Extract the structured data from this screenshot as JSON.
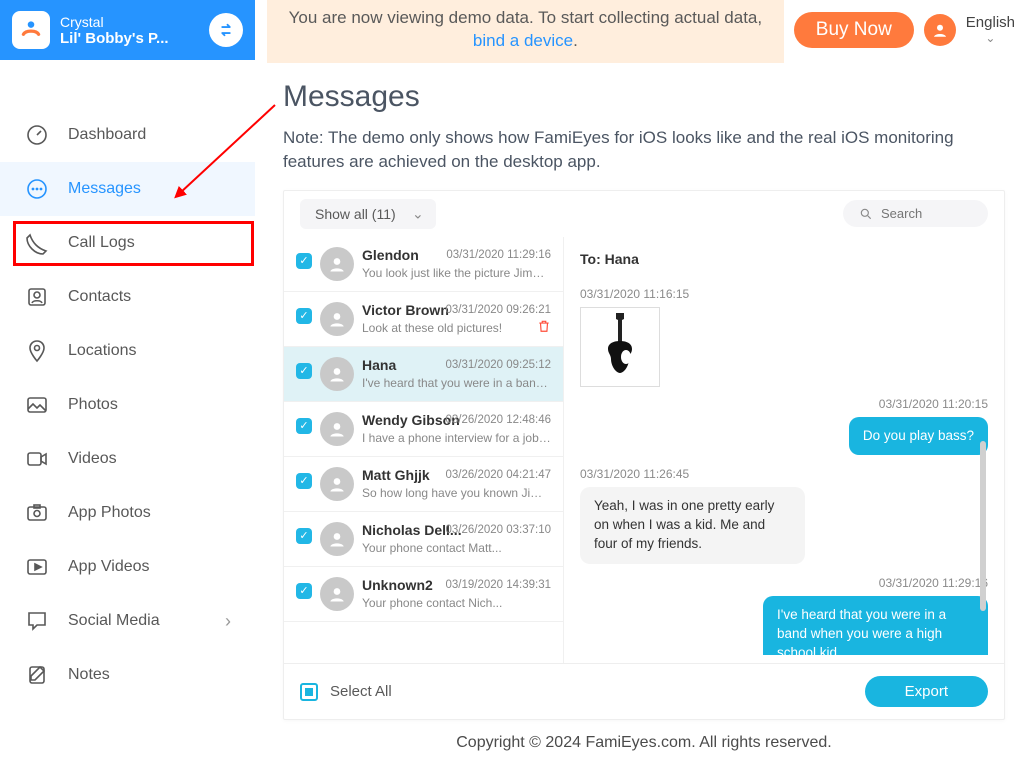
{
  "header": {
    "account_name": "Crystal",
    "device_name": "Lil' Bobby's P...",
    "demo_banner_pre": "You are now viewing demo data. To start collecting actual data, ",
    "demo_banner_link": "bind a device",
    "demo_banner_post": ".",
    "buy_now": "Buy Now",
    "language": "English"
  },
  "sidebar": {
    "items": [
      {
        "key": "dashboard",
        "label": "Dashboard"
      },
      {
        "key": "messages",
        "label": "Messages",
        "active": true
      },
      {
        "key": "call-logs",
        "label": "Call Logs"
      },
      {
        "key": "contacts",
        "label": "Contacts"
      },
      {
        "key": "locations",
        "label": "Locations"
      },
      {
        "key": "photos",
        "label": "Photos"
      },
      {
        "key": "videos",
        "label": "Videos"
      },
      {
        "key": "app-photos",
        "label": "App Photos"
      },
      {
        "key": "app-videos",
        "label": "App Videos"
      },
      {
        "key": "social-media",
        "label": "Social Media",
        "chevron": true
      },
      {
        "key": "notes",
        "label": "Notes"
      }
    ]
  },
  "page": {
    "title": "Messages",
    "note": "Note: The demo only shows how FamiEyes for iOS looks like and the real iOS monitoring features are achieved on the desktop app."
  },
  "filter": {
    "selected": "Show all (11)"
  },
  "search": {
    "placeholder": "Search"
  },
  "threads": [
    {
      "name": "Glendon",
      "preview": "You look just like the picture Jimmy sh...",
      "ts": "03/31/2020  11:29:16"
    },
    {
      "name": "Victor Brown",
      "preview": "Look at these old pictures!",
      "ts": "03/31/2020  09:26:21",
      "trash": true
    },
    {
      "name": "Hana",
      "preview": "I've heard that you were in a band whe...",
      "ts": "03/31/2020  09:25:12",
      "active": true
    },
    {
      "name": "Wendy Gibson",
      "preview": "I have a phone interview for a job in an...",
      "ts": "03/26/2020  12:48:46"
    },
    {
      "name": "Matt Ghjjk",
      "preview": "So how long have you known Jimmy...",
      "ts": "03/26/2020  04:21:47"
    },
    {
      "name": "Nicholas Dell...",
      "preview": "Your phone contact Matt...",
      "ts": "03/26/2020  03:37:10"
    },
    {
      "name": "Unknown2",
      "preview": "Your phone contact Nich...",
      "ts": "03/19/2020  14:39:31"
    }
  ],
  "chat": {
    "to_label": "To: Hana",
    "messages": [
      {
        "ts": "03/31/2020  11:16:15",
        "side": "left",
        "type": "image"
      },
      {
        "ts": "03/31/2020  11:20:15",
        "side": "right",
        "text": "Do you play bass?"
      },
      {
        "ts": "03/31/2020  11:26:45",
        "side": "left",
        "text": "Yeah, I was in one pretty early on when I was a kid. Me and four of my friends."
      },
      {
        "ts": "03/31/2020  11:29:16",
        "side": "right",
        "text": "I've heard that you were in a band when you were a high school kid."
      }
    ]
  },
  "footer_controls": {
    "select_all": "Select All",
    "export": "Export"
  },
  "copyright": "Copyright © 2024 FamiEyes.com. All rights reserved."
}
